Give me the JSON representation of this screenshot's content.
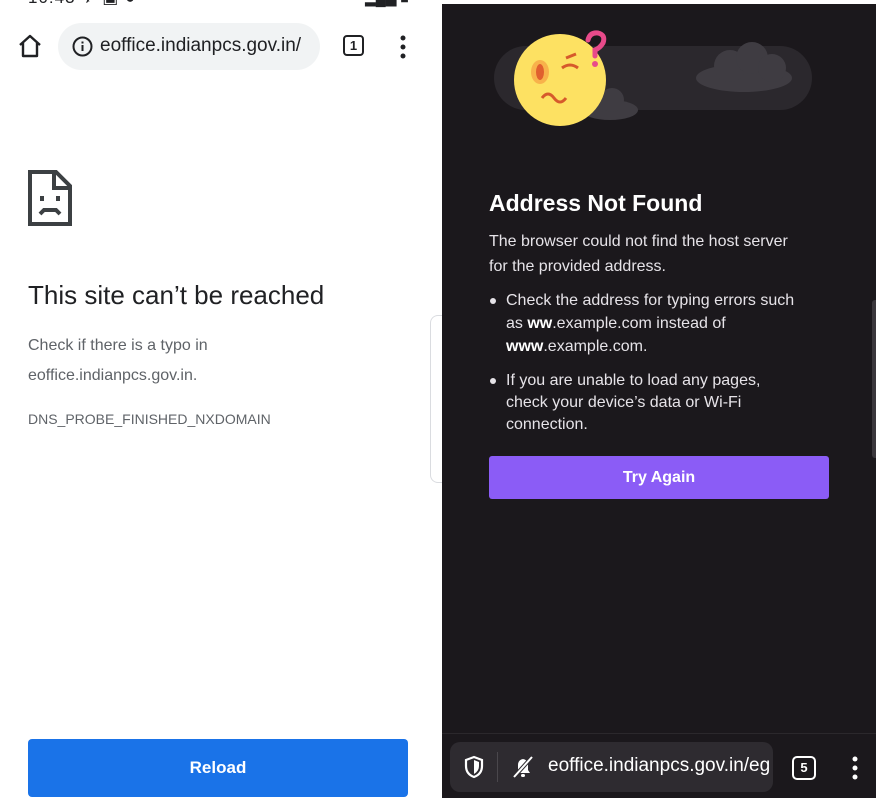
{
  "left_panel": {
    "url": "eoffice.indianpcs.gov.in/",
    "tab_count": "1",
    "title": "This site can’t be reached",
    "description_line1": "Check if there is a typo in",
    "description_line2": "eoffice.indianpcs.gov.in.",
    "error_code": "DNS_PROBE_FINISHED_NXDOMAIN",
    "reload_label": "Reload",
    "accent_color": "#1a73e8"
  },
  "right_panel": {
    "title": "Address Not Found",
    "description_line1": "The browser could not find the host server",
    "description_line2": "for the provided address.",
    "bullet1": {
      "line1": "Check the address for typing errors such",
      "line2_bold": "ww",
      "line2_rest": ".example.com instead of",
      "line2_prefix": "as ",
      "line3_bold": "www",
      "line3_rest": ".example.com."
    },
    "bullet2": {
      "line1": "If you are unable to load any pages,",
      "line2": "check your device’s data or Wi-Fi",
      "line3": "connection."
    },
    "try_again_label": "Try Again",
    "url": "eoffice.indianpcs.gov.in/eg",
    "tab_count": "5",
    "accent_color": "#8b5cf6",
    "background_color": "#1b181c"
  }
}
